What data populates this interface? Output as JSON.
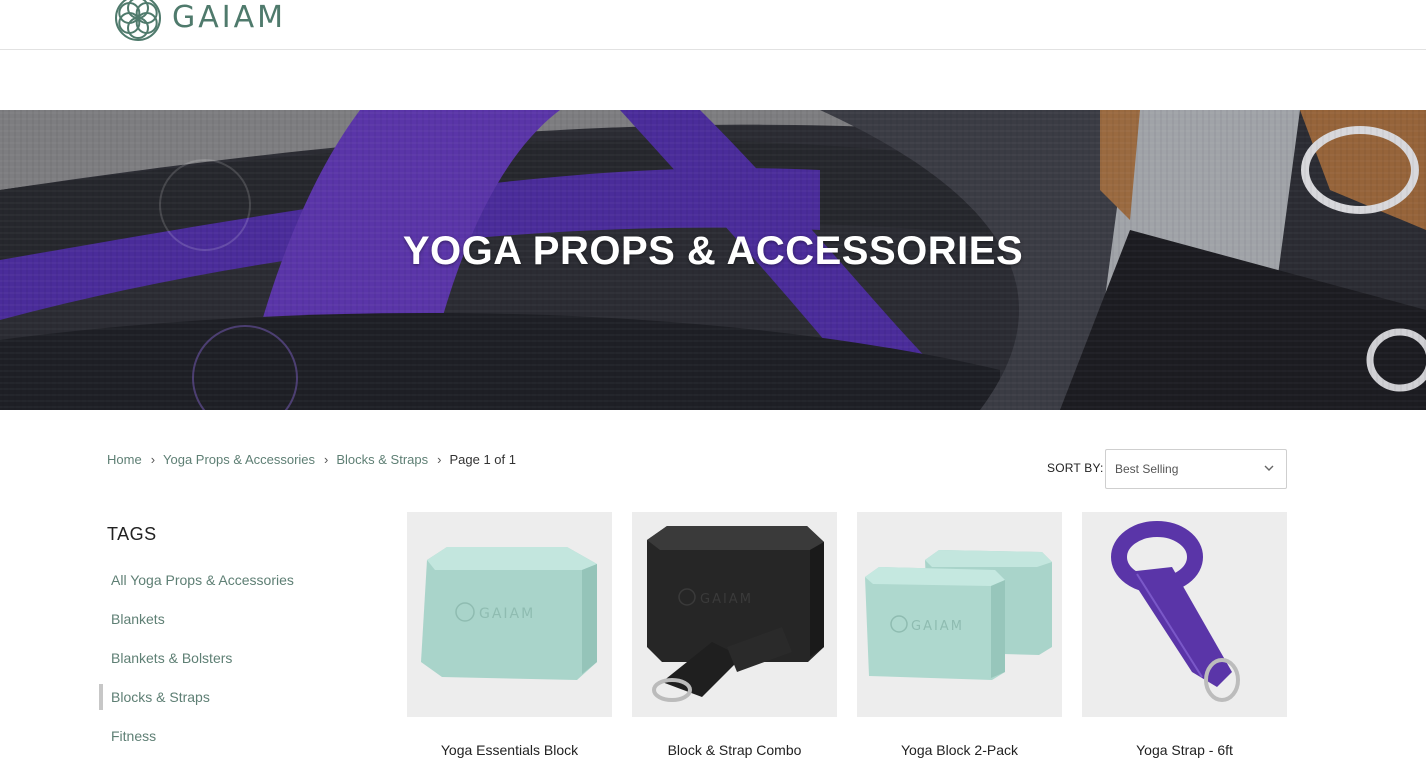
{
  "header": {
    "brand": "GAIAM"
  },
  "hero": {
    "title": "YOGA PROPS & ACCESSORIES"
  },
  "breadcrumb": {
    "items": [
      "Home",
      "Yoga Props & Accessories",
      "Blocks & Straps"
    ],
    "current": "Page 1 of 1"
  },
  "sort": {
    "label": "SORT BY:",
    "value": "Best Selling"
  },
  "tags": {
    "title": "TAGS",
    "items": [
      {
        "label": "All Yoga Props & Accessories"
      },
      {
        "label": "Blankets"
      },
      {
        "label": "Blankets & Bolsters"
      },
      {
        "label": "Blocks & Straps",
        "active": true
      },
      {
        "label": "Fitness"
      }
    ]
  },
  "products": [
    {
      "name": "Yoga Essentials Block"
    },
    {
      "name": "Block & Strap Combo"
    },
    {
      "name": "Yoga Block 2-Pack"
    },
    {
      "name": "Yoga Strap - 6ft"
    }
  ],
  "colors": {
    "brand_green": "#4f7a6c",
    "link_green": "#5e7f74",
    "mint_block": "#b5dcd3",
    "purple_strap": "#5a35a8"
  }
}
